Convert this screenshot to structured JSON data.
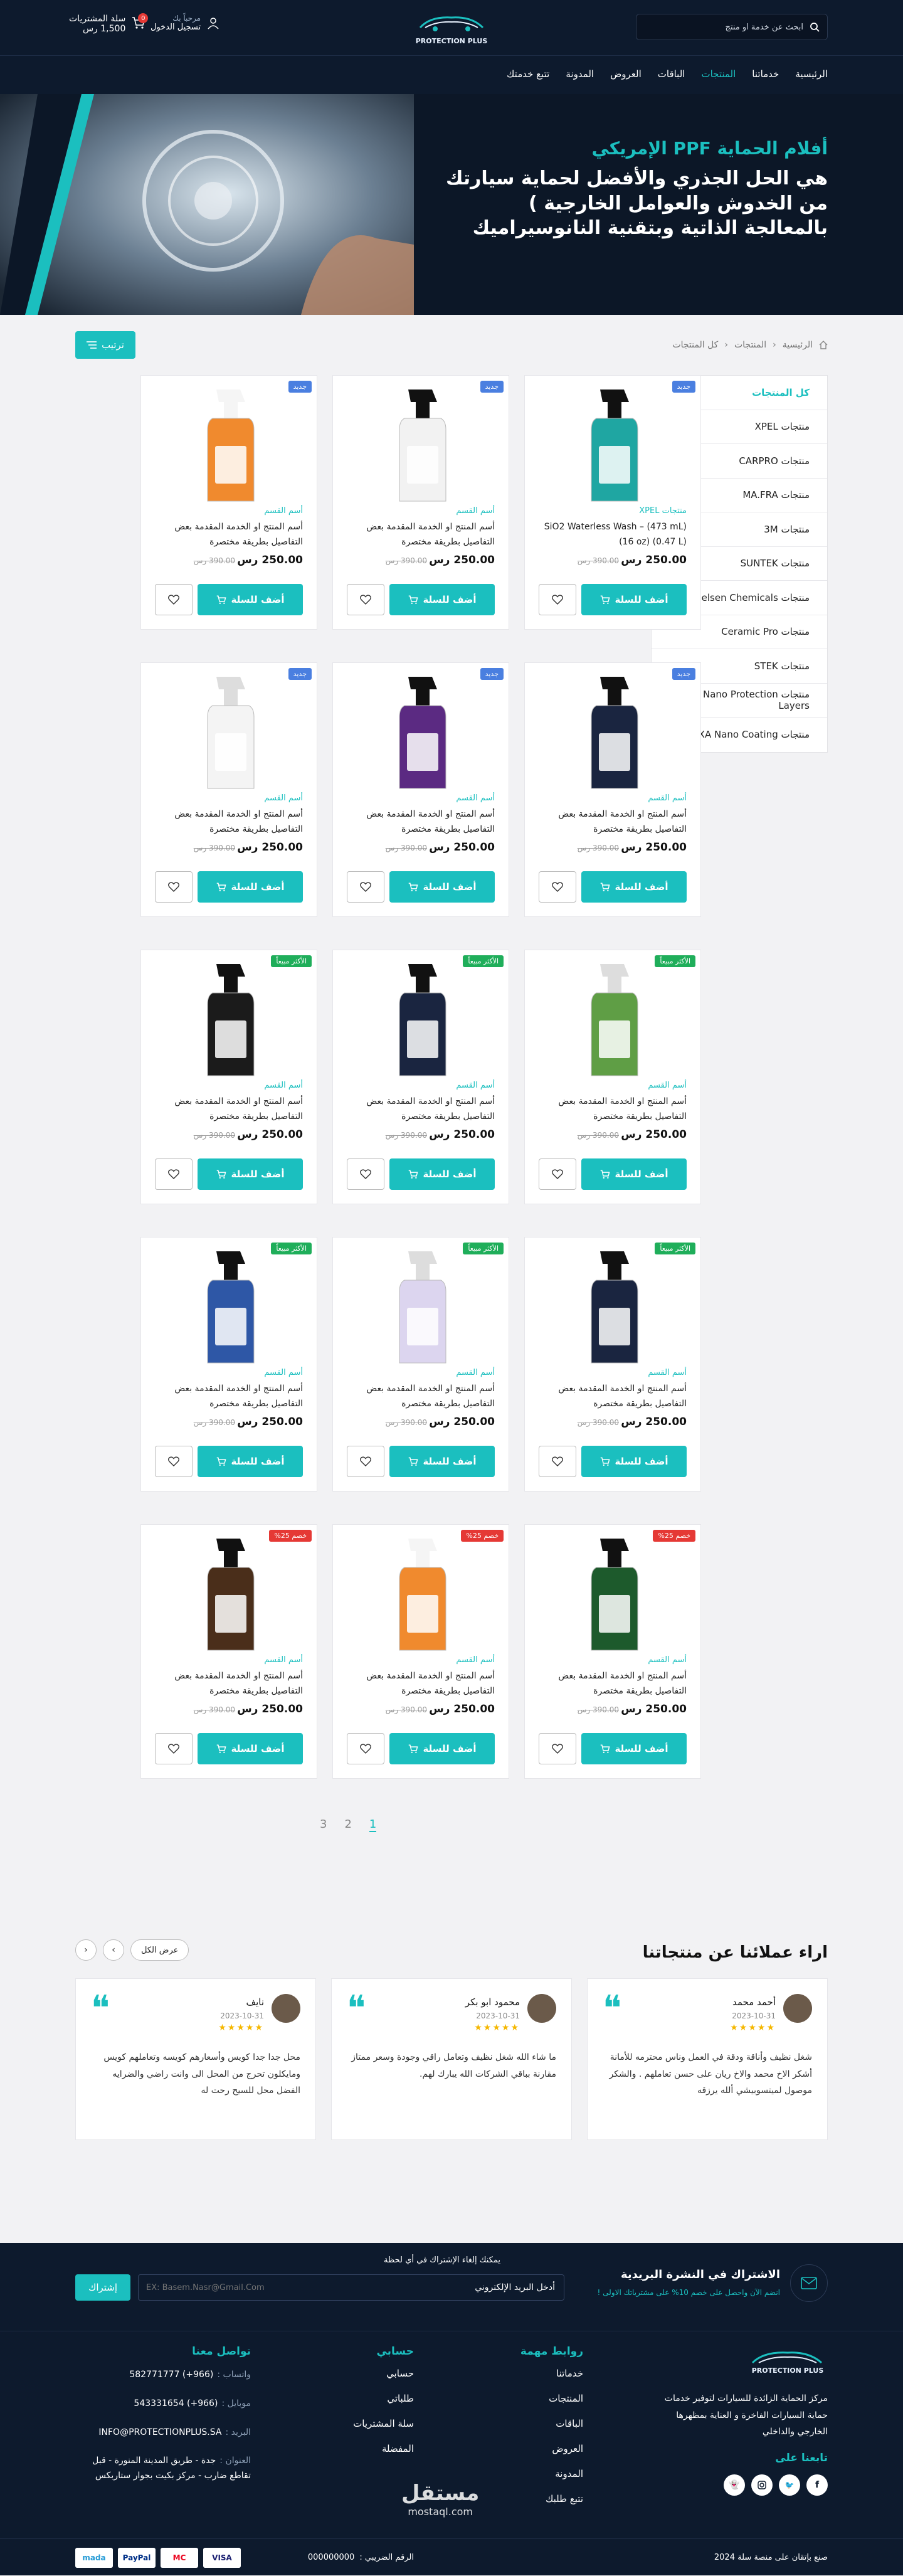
{
  "header": {
    "search_placeholder": "ابحث عن خدمة او منتج",
    "logo_text": "PROTECTION PLUS",
    "account_greeting": "مرحباً بك",
    "account_action": "تسجيل الدخول",
    "cart_label": "سلة المشتريات",
    "cart_total": "1,500 رس",
    "cart_count": "0"
  },
  "nav": [
    {
      "label": "الرئيسية",
      "active": false
    },
    {
      "label": "خدماتنا",
      "active": false
    },
    {
      "label": "المنتجات",
      "active": true
    },
    {
      "label": "الباقات",
      "active": false
    },
    {
      "label": "العروض",
      "active": false
    },
    {
      "label": "المدونة",
      "active": false
    },
    {
      "label": "تتبع خدمتك",
      "active": false
    }
  ],
  "hero": {
    "title": "أفلام الحماية PPF الإمريكي",
    "text": "هي الحل الجذري والأفضل لحماية سيارتك من الخدوش والعوامل الخارجية ) بالمعالجة الذاتية وبتقنية النانوسيراميك"
  },
  "breadcrumb": [
    "الرئيسية",
    "المنتجات",
    "كل المنتجات"
  ],
  "sort_label": "ترتيب",
  "sidebar": [
    "كل المنتجات",
    "منتجات XPEL",
    "منتجات CARPRO",
    "منتجات MA.FRA",
    "منتجات 3M",
    "منتجات SUNTEK",
    "منتجات Nielsen Chemicals",
    "منتجات Ceramic Pro",
    "منتجات STEK",
    "منتجات Nano Protection Layers",
    "منتجات HEXA Nano Coating"
  ],
  "colors": {
    "accent": "#1bbfbf",
    "navy": "#0d1a2d",
    "new": "#4a7fe0",
    "best": "#1fae5a",
    "sale": "#e53935"
  },
  "products": [
    {
      "badge": "جديد",
      "badge_type": "new",
      "category": "منتجات XPEL",
      "title": "SiO2 Waterless Wash – (473 mL) (16 oz) (0.47 L)",
      "price": "250.00 رس",
      "old_price": "390.00 رس",
      "bottle": "teal"
    },
    {
      "badge": "جديد",
      "badge_type": "new",
      "category": "أسم القسم",
      "title": "أسم المنتج او الخدمة المقدمة بعض التفاصيل بطريقة مختصرة",
      "price": "250.00 رس",
      "old_price": "390.00 رس",
      "bottle": "white-black"
    },
    {
      "badge": "جديد",
      "badge_type": "new",
      "category": "أسم القسم",
      "title": "أسم المنتج او الخدمة المقدمة بعض التفاصيل بطريقة مختصرة",
      "price": "250.00 رس",
      "old_price": "390.00 رس",
      "bottle": "orange"
    },
    {
      "badge": "جديد",
      "badge_type": "new",
      "category": "أسم القسم",
      "title": "أسم المنتج او الخدمة المقدمة بعض التفاصيل بطريقة مختصرة",
      "price": "250.00 رس",
      "old_price": "390.00 رس",
      "bottle": "navy"
    },
    {
      "badge": "جديد",
      "badge_type": "new",
      "category": "أسم القسم",
      "title": "أسم المنتج او الخدمة المقدمة بعض التفاصيل بطريقة مختصرة",
      "price": "250.00 رس",
      "old_price": "390.00 رس",
      "bottle": "purple"
    },
    {
      "badge": "جديد",
      "badge_type": "new",
      "category": "أسم القسم",
      "title": "أسم المنتج او الخدمة المقدمة بعض التفاصيل بطريقة مختصرة",
      "price": "250.00 رس",
      "old_price": "390.00 رس",
      "bottle": "white"
    },
    {
      "badge": "الأكثر مبيعاً",
      "badge_type": "best",
      "category": "أسم القسم",
      "title": "أسم المنتج او الخدمة المقدمة بعض التفاصيل بطريقة مختصرة",
      "price": "250.00 رس",
      "old_price": "390.00 رس",
      "bottle": "green"
    },
    {
      "badge": "الأكثر مبيعاً",
      "badge_type": "best",
      "category": "أسم القسم",
      "title": "أسم المنتج او الخدمة المقدمة بعض التفاصيل بطريقة مختصرة",
      "price": "250.00 رس",
      "old_price": "390.00 رس",
      "bottle": "navy"
    },
    {
      "badge": "الأكثر مبيعاً",
      "badge_type": "best",
      "category": "أسم القسم",
      "title": "أسم المنتج او الخدمة المقدمة بعض التفاصيل بطريقة مختصرة",
      "price": "250.00 رس",
      "old_price": "390.00 رس",
      "bottle": "black"
    },
    {
      "badge": "الأكثر مبيعاً",
      "badge_type": "best",
      "category": "أسم القسم",
      "title": "أسم المنتج او الخدمة المقدمة بعض التفاصيل بطريقة مختصرة",
      "price": "250.00 رس",
      "old_price": "390.00 رس",
      "bottle": "navy"
    },
    {
      "badge": "الأكثر مبيعاً",
      "badge_type": "best",
      "category": "أسم القسم",
      "title": "أسم المنتج او الخدمة المقدمة بعض التفاصيل بطريقة مختصرة",
      "price": "250.00 رس",
      "old_price": "390.00 رس",
      "bottle": "lavender"
    },
    {
      "badge": "الأكثر مبيعاً",
      "badge_type": "best",
      "category": "أسم القسم",
      "title": "أسم المنتج او الخدمة المقدمة بعض التفاصيل بطريقة مختصرة",
      "price": "250.00 رس",
      "old_price": "390.00 رس",
      "bottle": "towel"
    },
    {
      "badge": "خصم 25%",
      "badge_type": "sale",
      "category": "أسم القسم",
      "title": "أسم المنتج او الخدمة المقدمة بعض التفاصيل بطريقة مختصرة",
      "price": "250.00 رس",
      "old_price": "390.00 رس",
      "bottle": "darkgreen"
    },
    {
      "badge": "خصم 25%",
      "badge_type": "sale",
      "category": "أسم القسم",
      "title": "أسم المنتج او الخدمة المقدمة بعض التفاصيل بطريقة مختصرة",
      "price": "250.00 رس",
      "old_price": "390.00 رس",
      "bottle": "orange"
    },
    {
      "badge": "خصم 25%",
      "badge_type": "sale",
      "category": "أسم القسم",
      "title": "أسم المنتج او الخدمة المقدمة بعض التفاصيل بطريقة مختصرة",
      "price": "250.00 رس",
      "old_price": "390.00 رس",
      "bottle": "brown"
    }
  ],
  "add_to_cart": "أضف للسلة",
  "pagination": [
    "1",
    "2",
    "3"
  ],
  "reviews_title": "اراء عملائنا عن منتجاتنا",
  "reviews_view_all": "عرض الكل",
  "reviews": [
    {
      "name": "أحمد محمد",
      "date": "2023-10-31",
      "stars": "★★★★★",
      "text": "شغل نظيف وأناقة ودقة في العمل وناس محترمه للأمانة أشكر الاخ محمد والاخ ريان على حسن تعاملهم . والشكر موصول لميتسوبيشي ألله يرزقه"
    },
    {
      "name": "محمود ابو بكر",
      "date": "2023-10-31",
      "stars": "★★★★★",
      "text": "ما شاء الله شغل نظيف وتعامل راقي وجودة وسعر ممتاز مقارنة بباقي الشركات الله يبارك لهم."
    },
    {
      "name": "نايف",
      "date": "2023-10-31",
      "stars": "★★★★★",
      "text": "محل جدا جدا كويس وأسعارهم كويسه وتعاملهم كويس ومايكلون تحرج من المحل الى وانت راضي والضرايه الفضل محل للسيح رحت له"
    }
  ],
  "newsletter": {
    "title": "الاشتراك في النشرة البريدية",
    "subtitle": "انضم الآن واحصل على خصم 10% على مشترياتك الاولى !",
    "note": "يمكنك إلغاء الإشتراك في أي لحظة",
    "field_label": "أدخل البريد الإلكتروني",
    "placeholder": "EX: Basem.Nasr@Gmail.Com",
    "button": "إشتراك"
  },
  "footer": {
    "about": "مركز الحماية الزائدة للسيارات لتوفير خدمات حماية السيارات الفاخرة و العناية بمظهرها الخارجي والداخلي",
    "follow": "تابعنا على",
    "links_title": "روابط مهمة",
    "links": [
      "خدماتنا",
      "المنتجات",
      "الباقات",
      "العروض",
      "المدونة",
      "تتبع طلبك"
    ],
    "account_title": "حسابي",
    "account_links": [
      "حسابي",
      "طلباتي",
      "سلة المشتريات",
      "المفضلة"
    ],
    "contact_title": "تواصل معنا",
    "contact": [
      {
        "k": "واتساب :",
        "v": "(966+) 582771777"
      },
      {
        "k": "موبايل :",
        "v": "(966+) 543331654"
      },
      {
        "k": "البريد :",
        "v": "INFO@PROTECTIONPLUS.SA"
      },
      {
        "k": "العنوان :",
        "v": "جدة - طريق المدينة المنورة - قبل تقاطع ضارب - مركز بكيت بجوار ستاربكس"
      }
    ],
    "copyright": "صنع بإتقان على منصة سلة 2024",
    "tax_label": "الرقم الضريبي :",
    "tax_value": "000000000",
    "payments": [
      "VISA",
      "MC",
      "PayPal",
      "mada"
    ]
  },
  "watermark": {
    "ar": "مستقل",
    "en": "mostaql.com"
  }
}
